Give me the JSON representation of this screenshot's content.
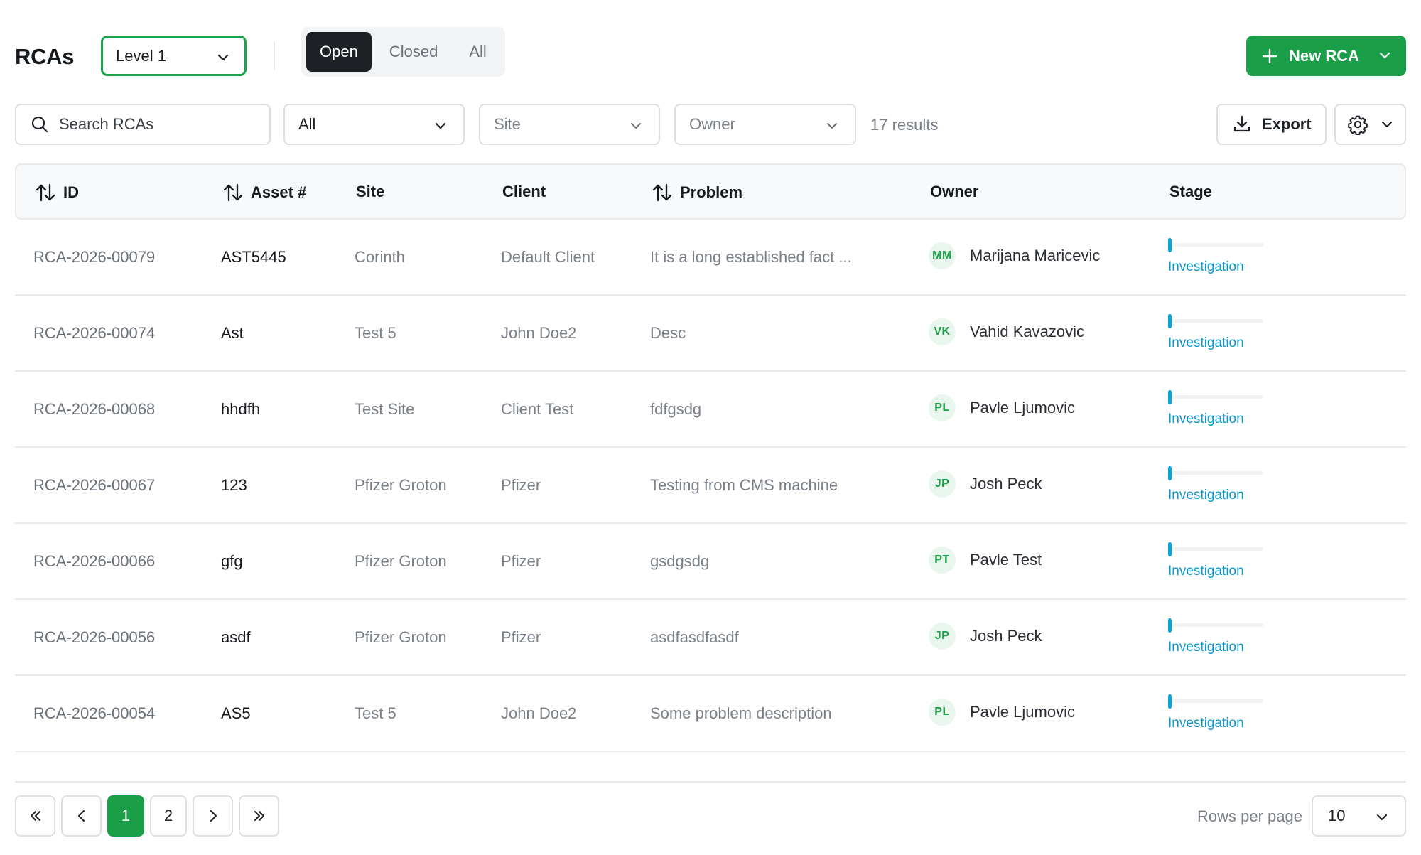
{
  "header": {
    "title": "RCAs",
    "level_select": "Level 1",
    "status_tabs": [
      "Open",
      "Closed",
      "All"
    ],
    "active_status_tab": "Open",
    "new_button": "New RCA",
    "accent": "#1a9e48"
  },
  "filters": {
    "search_placeholder": "Search RCAs",
    "type_filter": "All",
    "site_filter": "Site",
    "owner_filter": "Owner",
    "results": "17 results",
    "export_label": "Export"
  },
  "table": {
    "columns": {
      "id": "ID",
      "asset": "Asset #",
      "site": "Site",
      "client": "Client",
      "problem": "Problem",
      "owner": "Owner",
      "stage": "Stage"
    },
    "rows": [
      {
        "id": "RCA-2026-00079",
        "asset": "AST5445",
        "site": "Corinth",
        "client": "Default Client",
        "problem": "It is a long established fact ...",
        "initials": "MM",
        "owner": "Marijana Maricevic",
        "stage": "Investigation"
      },
      {
        "id": "RCA-2026-00074",
        "asset": "Ast",
        "site": "Test 5",
        "client": "John Doe2",
        "problem": "Desc",
        "initials": "VK",
        "owner": "Vahid Kavazovic",
        "stage": "Investigation"
      },
      {
        "id": "RCA-2026-00068",
        "asset": "hhdfh",
        "site": "Test Site",
        "client": "Client Test",
        "problem": "fdfgsdg",
        "initials": "PL",
        "owner": "Pavle Ljumovic",
        "stage": "Investigation"
      },
      {
        "id": "RCA-2026-00067",
        "asset": "123",
        "site": "Pfizer Groton",
        "client": "Pfizer",
        "problem": "Testing from CMS machine",
        "initials": "JP",
        "owner": "Josh Peck",
        "stage": "Investigation"
      },
      {
        "id": "RCA-2026-00066",
        "asset": "gfg",
        "site": "Pfizer Groton",
        "client": "Pfizer",
        "problem": "gsdgsdg",
        "initials": "PT",
        "owner": "Pavle Test",
        "stage": "Investigation"
      },
      {
        "id": "RCA-2026-00056",
        "asset": "asdf",
        "site": "Pfizer Groton",
        "client": "Pfizer",
        "problem": "asdfasdfasdf",
        "initials": "JP",
        "owner": "Josh Peck",
        "stage": "Investigation"
      },
      {
        "id": "RCA-2026-00054",
        "asset": "AS5",
        "site": "Test 5",
        "client": "John Doe2",
        "problem": "Some problem description",
        "initials": "PL",
        "owner": "Pavle Ljumovic",
        "stage": "Investigation"
      }
    ]
  },
  "pagination": {
    "pages": [
      "1",
      "2"
    ],
    "current_page": "1",
    "rows_per_page_label": "Rows per page",
    "rows_per_page": "10"
  }
}
